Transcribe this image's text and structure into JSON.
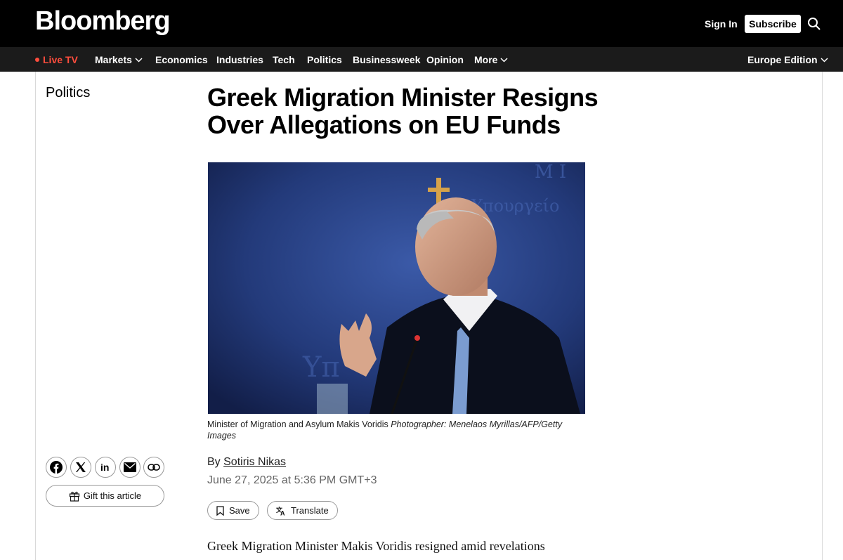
{
  "header": {
    "logo": "Bloomberg",
    "sign_in": "Sign In",
    "subscribe": "Subscribe",
    "search_icon": "search-icon"
  },
  "nav": {
    "live_tv": "Live TV",
    "items": [
      "Markets",
      "Economics",
      "Industries",
      "Tech",
      "Politics",
      "Businessweek",
      "Opinion",
      "More"
    ],
    "edition": "Europe Edition"
  },
  "article": {
    "section": "Politics",
    "headline": "Greek Migration Minister Resigns Over Allegations on EU Funds",
    "caption_text": "Minister of Migration and Asylum Makis Voridis ",
    "caption_credit": "Photographer: Menelaos Myrillas/AFP/Getty Images",
    "by_prefix": "By ",
    "author": "Sotiris Nikas",
    "date": "June 27, 2025 at 5:36 PM GMT+3",
    "save_label": "Save",
    "translate_label": "Translate",
    "gift_label": "Gift this article",
    "body_line": "Greek Migration Minister Makis Voridis resigned amid revelations"
  },
  "colors": {
    "live_red": "#ff4d3d",
    "topbar": "#000000",
    "navbar": "#1b1b1b"
  }
}
